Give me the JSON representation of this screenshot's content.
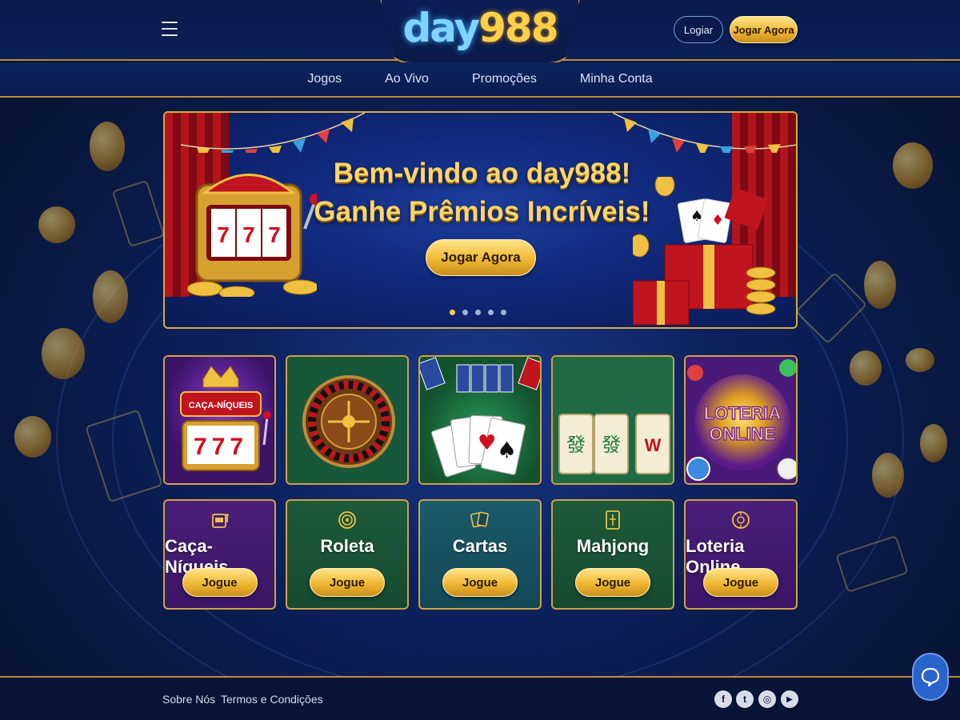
{
  "brand": {
    "logo_part1": "day",
    "logo_part2": "988"
  },
  "header": {
    "login_label": "Logiar",
    "play_label": "Jogar Agora",
    "menu_icon": "hamburger-icon"
  },
  "nav": {
    "items": [
      {
        "label": "Jogos"
      },
      {
        "label": "Ao Vivo"
      },
      {
        "label": "Promoções"
      },
      {
        "label": "Minha Conta"
      }
    ]
  },
  "hero": {
    "line1": "Bem-vindo ao day988!",
    "line2": "Ganhe Prêmios Incríveis!",
    "button_label": "Jogar Agora",
    "slide_count": 5,
    "active_slide": 1,
    "slot_symbols": "777"
  },
  "tiles": {
    "slots_sign": "CAÇA-NÍQUEIS",
    "slots_reels": "777",
    "lottery_line1": "LOTERIA",
    "lottery_line2": "ONLINE"
  },
  "games": [
    {
      "name": "Caça-Níqueis",
      "button": "Jogue",
      "icon": "slot-machine-icon"
    },
    {
      "name": "Roleta",
      "button": "Jogue",
      "icon": "roulette-icon"
    },
    {
      "name": "Cartas",
      "button": "Jogue",
      "icon": "cards-icon"
    },
    {
      "name": "Mahjong",
      "button": "Jogue",
      "icon": "mahjong-tile-icon"
    },
    {
      "name": "Loteria Online",
      "button": "Jogue",
      "icon": "lottery-ball-icon"
    }
  ],
  "footer": {
    "links": [
      {
        "label": "Sobre Nós"
      },
      {
        "label": "Termos e Condições"
      }
    ],
    "social": [
      {
        "icon": "facebook-icon",
        "glyph": "f"
      },
      {
        "icon": "twitter-icon",
        "glyph": "t"
      },
      {
        "icon": "instagram-icon",
        "glyph": "◎"
      },
      {
        "icon": "youtube-icon",
        "glyph": "▶"
      }
    ]
  },
  "colors": {
    "gold": "#f0b833",
    "navy": "#0a1a4a",
    "purple": "#4a1f7a",
    "green": "#1d5a3a",
    "teal": "#1a5a6a"
  }
}
